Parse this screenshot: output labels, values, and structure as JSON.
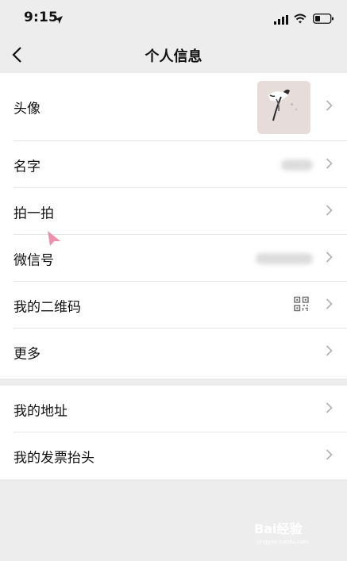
{
  "status_bar": {
    "time": "9:15"
  },
  "nav": {
    "title": "个人信息"
  },
  "profile_items": [
    {
      "label": "头像"
    },
    {
      "label": "名字"
    },
    {
      "label": "拍一拍"
    },
    {
      "label": "微信号"
    },
    {
      "label": "我的二维码"
    },
    {
      "label": "更多"
    }
  ],
  "other_items": [
    {
      "label": "我的地址"
    },
    {
      "label": "我的发票抬头"
    }
  ],
  "watermark": {
    "brand": "Bai经验",
    "sub": "jingyan.baidu.com"
  },
  "icons": [
    "location-arrow-icon",
    "signal-icon",
    "wifi-icon",
    "battery-icon",
    "back-icon",
    "chevron-right-icon",
    "qr-code-icon",
    "cursor-icon"
  ],
  "colors": {
    "background": "#ededed",
    "card": "#ffffff",
    "chevron": "#b2b2b2",
    "cursor": "#ee8fae"
  }
}
